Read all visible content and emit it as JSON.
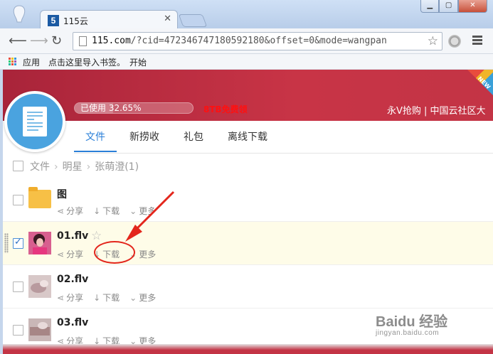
{
  "browser": {
    "tab_title": "115云",
    "tab_favicon": "5",
    "url_host": "115.com",
    "url_rest": "/?cid=472346747180592180&offset=0&mode=wangpan",
    "bookmarks": [
      "应用",
      "点击这里导入书签。",
      "开始"
    ]
  },
  "banner": {
    "usage_label": "已使用 32.65%",
    "usage_percent": 32.65,
    "promo": "8TB免费领",
    "slogan": "永V抢购 | 中国云社区大",
    "new_badge": "NEW"
  },
  "nav": {
    "tabs": [
      "文件",
      "新捞收",
      "礼包",
      "离线下载"
    ],
    "active": 0
  },
  "breadcrumb": {
    "items": [
      "文件",
      "明星",
      "张萌澄(1)"
    ]
  },
  "actions": {
    "share": "分享",
    "download": "下载",
    "more": "更多"
  },
  "files": [
    {
      "name": "图",
      "type": "folder",
      "checked": false
    },
    {
      "name": "01.flv",
      "type": "video",
      "checked": true
    },
    {
      "name": "02.flv",
      "type": "video",
      "checked": false
    },
    {
      "name": "03.flv",
      "type": "video",
      "checked": false
    }
  ],
  "watermark": {
    "text": "Baidu 经验",
    "sub": "jingyan.baidu.com"
  },
  "colors": {
    "banner": "#c33445",
    "accent": "#2a7fd8",
    "annotation": "#e3261c"
  }
}
